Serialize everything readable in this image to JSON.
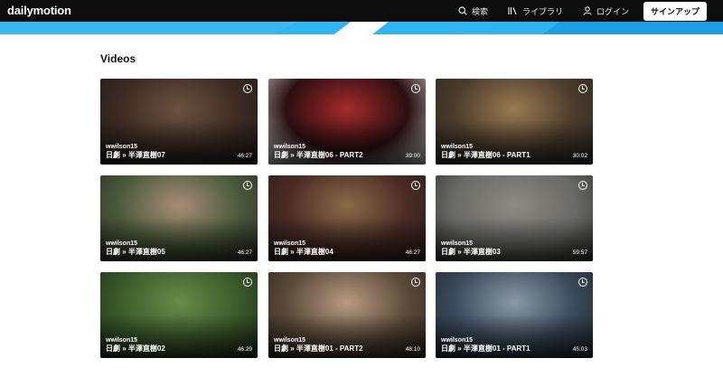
{
  "header": {
    "logo": "dailymotion",
    "search_label": "検索",
    "library_label": "ライブラリ",
    "login_label": "ログイン",
    "signup_label": "サインアップ"
  },
  "section": {
    "title": "Videos"
  },
  "videos": [
    {
      "owner": "wwilson15",
      "title": "日劇 » 半澤直樹07",
      "duration": "46:27",
      "colors": [
        "#3b2a22",
        "#6b5240",
        "#1d1a19"
      ]
    },
    {
      "owner": "wwilson15",
      "title": "日劇 » 半澤直樹06 - PART2",
      "duration": "39:00",
      "colors": [
        "#2a0f12",
        "#a52a2a",
        "#c9c9c9"
      ]
    },
    {
      "owner": "wwilson15",
      "title": "日劇 » 半澤直樹06 - PART1",
      "duration": "30:02",
      "colors": [
        "#4a3b2b",
        "#9a7a52",
        "#2a2622"
      ]
    },
    {
      "owner": "wwilson15",
      "title": "日劇 » 半澤直樹05",
      "duration": "46:27",
      "colors": [
        "#4a5a3a",
        "#a88d78",
        "#2e2a26"
      ]
    },
    {
      "owner": "wwilson15",
      "title": "日劇 » 半澤直樹04",
      "duration": "46:27",
      "colors": [
        "#4a2b24",
        "#8a6a4a",
        "#2a1d1a"
      ]
    },
    {
      "owner": "wwilson15",
      "title": "日劇 » 半澤直樹03",
      "duration": "59:57",
      "colors": [
        "#6a6a66",
        "#8c8a84",
        "#2f2f2e"
      ]
    },
    {
      "owner": "wwilson15",
      "title": "日劇 » 半澤直樹02",
      "duration": "46:29",
      "colors": [
        "#3a5a2a",
        "#6a8a4a",
        "#1d2a1a"
      ]
    },
    {
      "owner": "wwilson15",
      "title": "日劇 » 半澤直樹01 - PART2",
      "duration": "48:10",
      "colors": [
        "#5a4a3a",
        "#b89a80",
        "#2a221c"
      ]
    },
    {
      "owner": "wwilson15",
      "title": "日劇 » 半澤直樹01 - PART1",
      "duration": "45:03",
      "colors": [
        "#3a4a5a",
        "#8a98a6",
        "#1f252b"
      ]
    }
  ]
}
